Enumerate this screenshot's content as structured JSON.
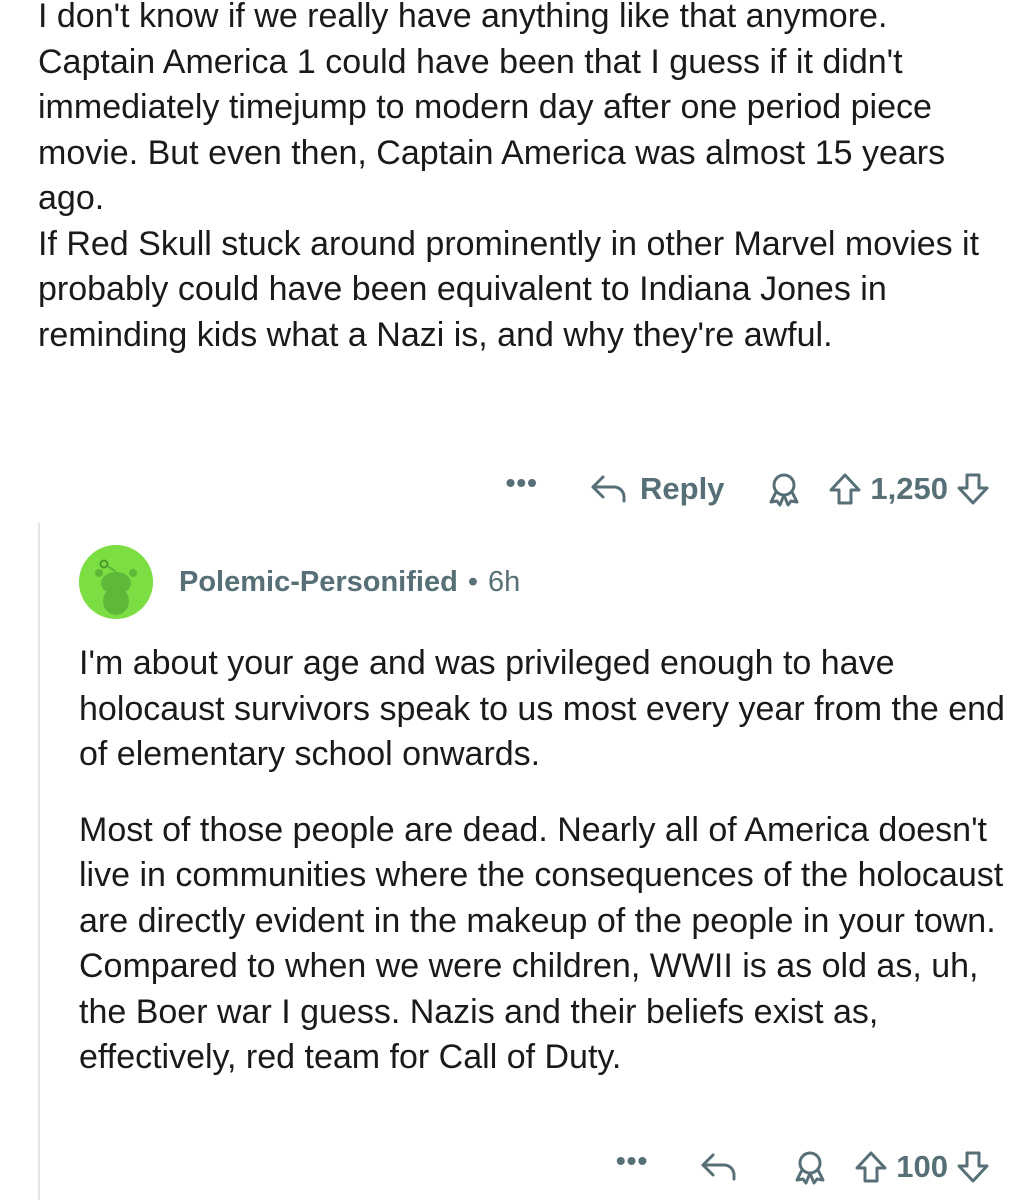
{
  "parent_comment": {
    "paragraphs": [
      "I don't know if we really have anything like that anymore.",
      "Captain America 1 could have been that I guess if it didn't immediately timejump to modern day after one period piece movie. But even then, Captain America was almost 15 years ago.",
      "If Red Skull stuck around prominently in other Marvel movies it probably could have been equivalent to Indiana Jones in reminding kids what a Nazi is, and why they're awful."
    ],
    "actions": {
      "more": "•••",
      "reply_label": "Reply",
      "vote_count": "1,250"
    }
  },
  "child_comment": {
    "username": "Polemic-Personified",
    "separator": "•",
    "timestamp": "6h",
    "paragraphs": [
      "I'm about your age and was privileged enough to have holocaust survivors speak to us most every year from the end of elementary school onwards.",
      "Most of those people are dead. Nearly all of America doesn't live in communities where the consequences of the holocaust are directly evident in the makeup of the people in your town. Compared to when we were children, WWII is as old as, uh, the Boer war I guess. Nazis and their beliefs exist as, effectively, red team for Call of Duty."
    ],
    "actions": {
      "more": "•••",
      "vote_count": "100"
    }
  },
  "icons": {
    "reply": "reply-arrow-icon",
    "award": "award-icon",
    "upvote": "upvote-arrow-icon",
    "downvote": "downvote-arrow-icon",
    "avatar": "snoo-avatar-icon"
  },
  "colors": {
    "text": "#1a1a1b",
    "meta": "#576f76",
    "avatar_bg": "#7bde43",
    "thread_line": "#e3e6e8"
  }
}
